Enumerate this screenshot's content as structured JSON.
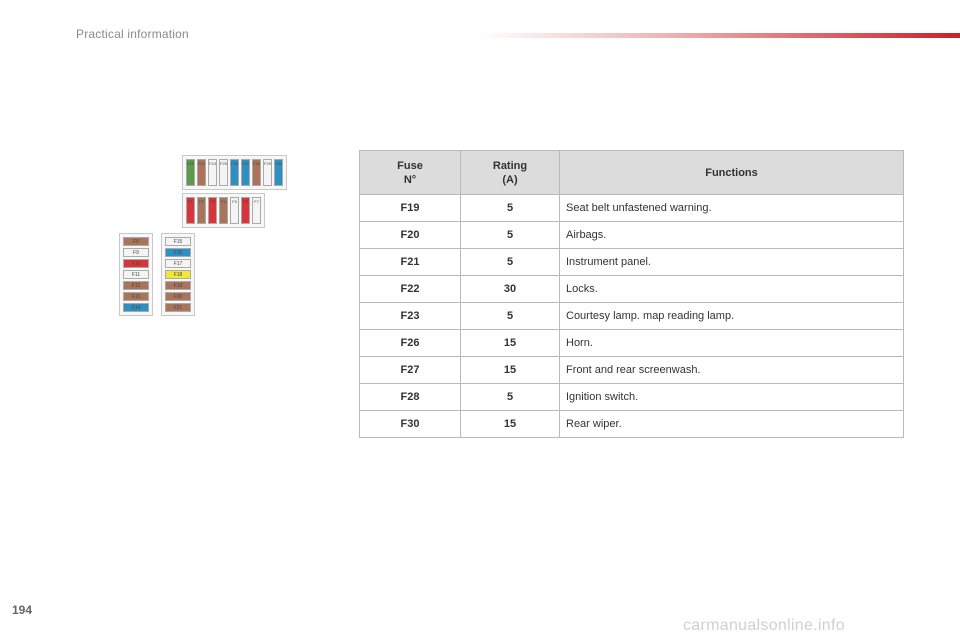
{
  "header": {
    "section_title": "Practical information"
  },
  "footer": {
    "page_number": "194",
    "watermark": "carmanualsonline.info"
  },
  "colors": {
    "accent": "#cc1f26",
    "table_header_bg": "#dcdcdc"
  },
  "diagram": {
    "top_row": [
      {
        "label": "F19",
        "color": "green"
      },
      {
        "label": "F21",
        "color": "brown"
      },
      {
        "label": "F24",
        "color": "white"
      },
      {
        "label": "F25",
        "color": "white"
      },
      {
        "label": "F26",
        "color": "blue"
      },
      {
        "label": "F27",
        "color": "blue"
      },
      {
        "label": "F28",
        "color": "brown"
      },
      {
        "label": "F29",
        "color": "white"
      },
      {
        "label": "F30",
        "color": "blue"
      }
    ],
    "middle_row": [
      {
        "label": "F1",
        "color": "red"
      },
      {
        "label": "F2",
        "color": "brown"
      },
      {
        "label": "F3",
        "color": "red"
      },
      {
        "label": "F4",
        "color": "brown"
      },
      {
        "label": "F5",
        "color": "white"
      },
      {
        "label": "F6",
        "color": "red"
      },
      {
        "label": "F7",
        "color": "white"
      }
    ],
    "left_column": [
      {
        "label": "F8",
        "color": "brown"
      },
      {
        "label": "F9",
        "color": "white"
      },
      {
        "label": "F10",
        "color": "red"
      },
      {
        "label": "F11",
        "color": "white"
      },
      {
        "label": "F12",
        "color": "brown"
      },
      {
        "label": "F13",
        "color": "brown"
      },
      {
        "label": "F14",
        "color": "blue"
      }
    ],
    "right_column": [
      {
        "label": "F15",
        "color": "white"
      },
      {
        "label": "F16",
        "color": "blue"
      },
      {
        "label": "F17",
        "color": "white"
      },
      {
        "label": "F18",
        "color": "yellow"
      },
      {
        "label": "F19",
        "color": "brown"
      },
      {
        "label": "F20",
        "color": "brown"
      },
      {
        "label": "F21",
        "color": "brown"
      }
    ]
  },
  "table": {
    "headers": {
      "fuse": "Fuse\nN°",
      "rating": "Rating\n(A)",
      "functions": "Functions"
    },
    "rows": [
      {
        "fuse": "F19",
        "rating": "5",
        "function": "Seat belt unfastened warning."
      },
      {
        "fuse": "F20",
        "rating": "5",
        "function": "Airbags."
      },
      {
        "fuse": "F21",
        "rating": "5",
        "function": "Instrument panel."
      },
      {
        "fuse": "F22",
        "rating": "30",
        "function": "Locks."
      },
      {
        "fuse": "F23",
        "rating": "5",
        "function": "Courtesy lamp. map reading lamp."
      },
      {
        "fuse": "F26",
        "rating": "15",
        "function": "Horn."
      },
      {
        "fuse": "F27",
        "rating": "15",
        "function": "Front and rear screenwash."
      },
      {
        "fuse": "F28",
        "rating": "5",
        "function": "Ignition switch."
      },
      {
        "fuse": "F30",
        "rating": "15",
        "function": "Rear wiper."
      }
    ]
  }
}
